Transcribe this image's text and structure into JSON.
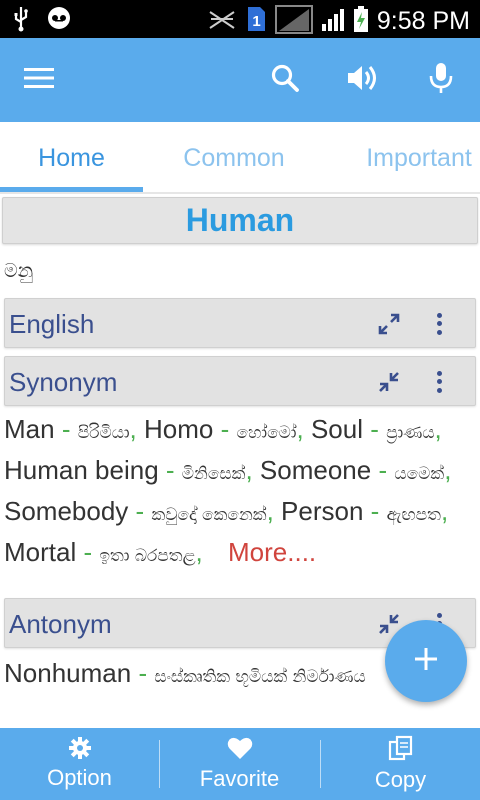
{
  "status_bar": {
    "time": "9:58 PM",
    "sim_badge": "1"
  },
  "app_bar": {
    "icons": [
      "menu-icon",
      "search-icon",
      "volume-icon",
      "mic-icon"
    ]
  },
  "tabs": [
    {
      "label": "Home",
      "active": true
    },
    {
      "label": "Common",
      "active": false
    },
    {
      "label": "Important",
      "active": false
    }
  ],
  "word": {
    "title": "Human",
    "meaning": "මනු"
  },
  "sections": {
    "english": {
      "label": "English"
    },
    "synonym": {
      "label": "Synonym"
    },
    "antonym": {
      "label": "Antonym"
    }
  },
  "synonyms": [
    {
      "en": "Man",
      "si": "පිරිමියා"
    },
    {
      "en": "Homo",
      "si": "හෝමෝ"
    },
    {
      "en": "Soul",
      "si": "ප්‍රාණය"
    },
    {
      "en": "Human being",
      "si": "මිනිසෙක්"
    },
    {
      "en": "Someone",
      "si": "යමෙක්"
    },
    {
      "en": "Somebody",
      "si": "කවුදෝ කෙනෙක්"
    },
    {
      "en": "Person",
      "si": "ඇඟපත"
    },
    {
      "en": "Mortal",
      "si": "ඉතා බරපතළ"
    }
  ],
  "more_label": "More....",
  "antonyms": [
    {
      "en": "Nonhuman",
      "si": "සංස්කෘතික භූමියක් නිර්මාණය"
    }
  ],
  "fab": {
    "icon": "plus-icon"
  },
  "bottom_bar": {
    "option": "Option",
    "favorite": "Favorite",
    "copy": "Copy"
  },
  "colors": {
    "primary": "#5aabec",
    "title": "#2b9be0",
    "section_text": "#3a4f8e",
    "separator": "#4caf50",
    "more": "#d0443d"
  }
}
